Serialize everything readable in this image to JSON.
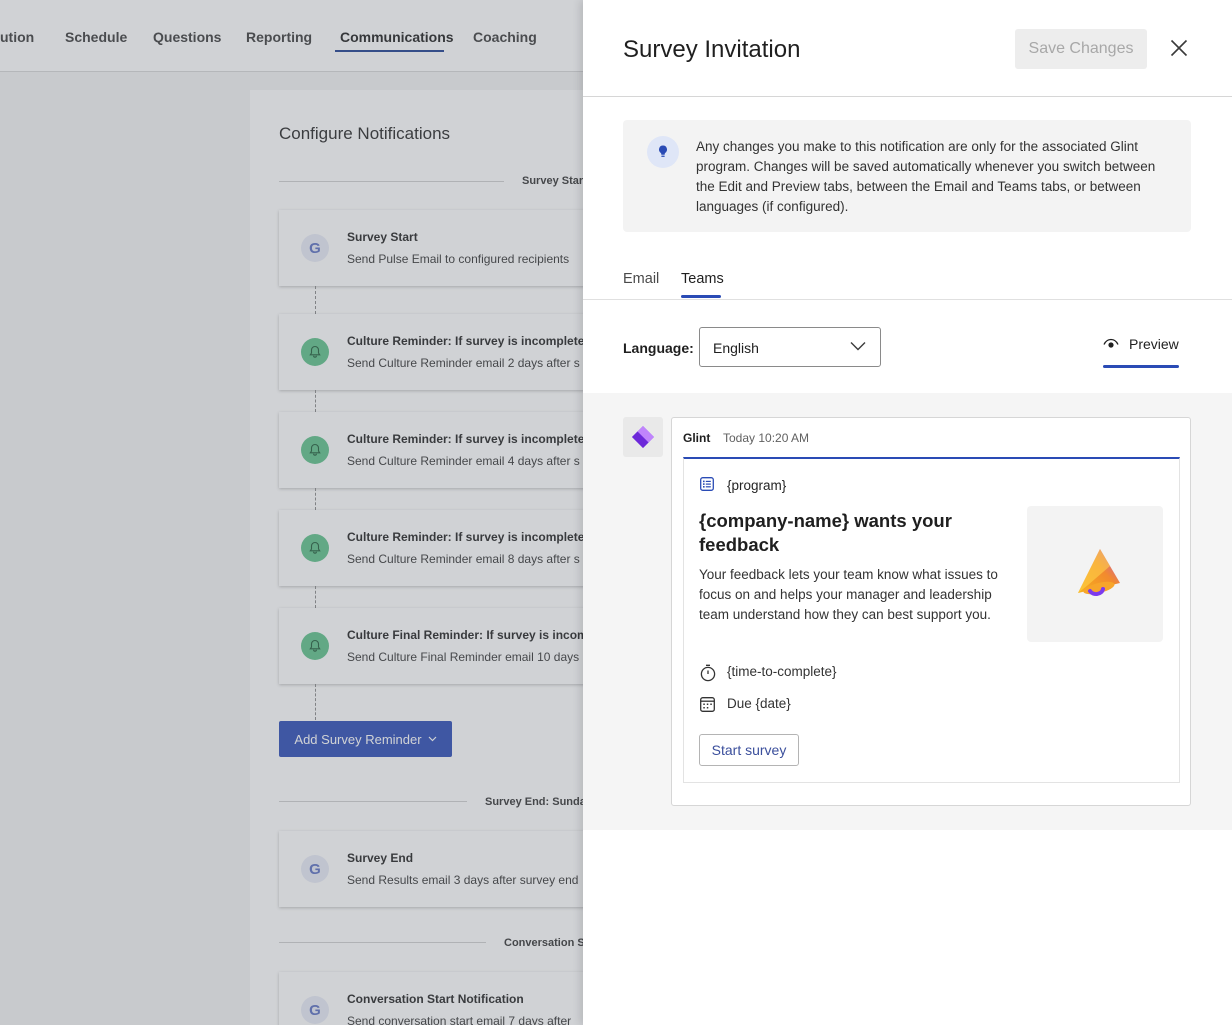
{
  "topnav": {
    "items": [
      {
        "label": "ution"
      },
      {
        "label": "Schedule"
      },
      {
        "label": "Questions"
      },
      {
        "label": "Reporting"
      },
      {
        "label": "Communications",
        "active": true
      },
      {
        "label": "Coaching"
      }
    ]
  },
  "config": {
    "title": "Configure Notifications",
    "sections": {
      "start": "Survey Start:",
      "end": "Survey End: Sunday,",
      "conversation": "Conversation Sta"
    },
    "notifications": [
      {
        "title": "Survey Start",
        "subtitle": "Send Pulse Email to configured recipients",
        "icon": "g-icon"
      },
      {
        "title": "Culture Reminder: If survey is incomplete",
        "subtitle": "Send Culture Reminder email 2 days after s",
        "icon": "bell-icon"
      },
      {
        "title": "Culture Reminder: If survey is incomplete",
        "subtitle": "Send Culture Reminder email 4 days after s",
        "icon": "bell-icon"
      },
      {
        "title": "Culture Reminder: If survey is incomplete",
        "subtitle": "Send Culture Reminder email 8 days after s",
        "icon": "bell-icon"
      },
      {
        "title": "Culture Final Reminder: If survey is incom",
        "subtitle": "Send Culture Final Reminder email 10 days",
        "icon": "bell-icon"
      },
      {
        "title": "Survey End",
        "subtitle": "Send Results email 3 days after survey end",
        "icon": "g-icon"
      },
      {
        "title": "Conversation Start Notification",
        "subtitle": "Send conversation start email 7 days after",
        "icon": "g-icon"
      }
    ],
    "add_reminder_label": "Add Survey Reminder"
  },
  "panel": {
    "title": "Survey Invitation",
    "save_label": "Save Changes",
    "info_text": "Any changes you make to this notification are only for the associated Glint program. Changes will be saved automatically whenever you switch between the Edit and Preview tabs, between the Email and Teams tabs, or between languages (if configured).",
    "tabs": [
      {
        "label": "Email"
      },
      {
        "label": "Teams",
        "active": true
      }
    ],
    "language_label": "Language:",
    "language_value": "English",
    "preview_label": "Preview"
  },
  "message": {
    "sender": "Glint",
    "time": "Today 10:20 AM",
    "program": "{program}",
    "headline": "{company-name} wants your feedback",
    "description": "Your feedback lets your team know what issues to focus on and helps your manager and leadership team understand how they can best support you.",
    "time_to_complete": "{time-to-complete}",
    "due": "Due {date}",
    "start_label": "Start survey"
  },
  "colors": {
    "accent": "#2a4bb5",
    "bell": "#5ec28a"
  }
}
